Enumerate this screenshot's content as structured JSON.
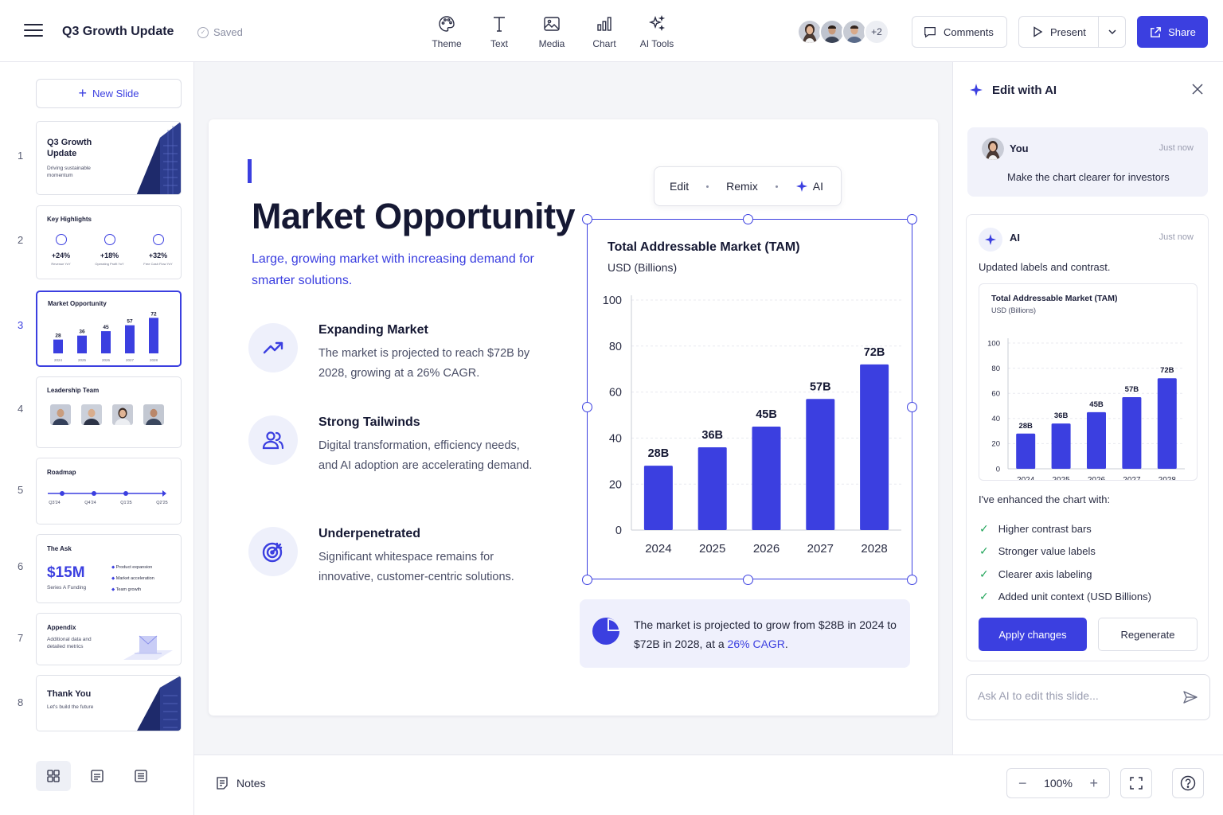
{
  "app": {
    "doc_title": "Q3 Growth Update",
    "saved_label": "Saved"
  },
  "toolbar": {
    "tools": [
      {
        "label": "Theme",
        "icon": "palette-icon"
      },
      {
        "label": "Text",
        "icon": "text-icon"
      },
      {
        "label": "Media",
        "icon": "image-icon"
      },
      {
        "label": "Chart",
        "icon": "chart-icon"
      },
      {
        "label": "AI Tools",
        "icon": "sparkles-icon"
      }
    ],
    "collaborators_more": "+2",
    "comments_label": "Comments",
    "present_label": "Present",
    "share_label": "Share"
  },
  "sidebar": {
    "new_slide_label": "New Slide",
    "thumbs": [
      {
        "num": "1",
        "title": "Q3 Growth Update",
        "subtitle": "Driving sustainable momentum"
      },
      {
        "num": "2",
        "title": "Key Highlights",
        "stats": [
          "+24%",
          "+18%",
          "+32%"
        ],
        "stat_labels": [
          "Revenue YoY",
          "Operating Profit YoY",
          "Free Cash Flow YoY"
        ]
      },
      {
        "num": "3",
        "title": "Market Opportunity",
        "values": [
          "28",
          "36",
          "45",
          "57",
          "72"
        ],
        "years": [
          "2024",
          "2025",
          "2026",
          "2027",
          "2028"
        ]
      },
      {
        "num": "4",
        "title": "Leadership Team"
      },
      {
        "num": "5",
        "title": "Roadmap",
        "quarters": [
          "Q3'24",
          "Q4'24",
          "Q1'25",
          "Q2'25"
        ]
      },
      {
        "num": "6",
        "title": "The Ask",
        "amount": "$15M",
        "amount_sub": "Series A Funding",
        "bullets": [
          "Product expansion",
          "Market acceleration",
          "Team growth"
        ]
      },
      {
        "num": "7",
        "title": "Appendix",
        "subtitle": "Additional data and detailed metrics"
      },
      {
        "num": "8",
        "title": "Thank You",
        "subtitle": "Let's build the future"
      }
    ]
  },
  "slide": {
    "title": "Market Opportunity",
    "subtitle": "Large, growing market with increasing demand for smarter solutions.",
    "features": [
      {
        "title": "Expanding Market",
        "desc": "The market is projected to reach $72B by 2028, growing at a 26% CAGR.",
        "icon": "trend-up-icon"
      },
      {
        "title": "Strong Tailwinds",
        "desc": "Digital transformation, efficiency needs, and AI adoption are accelerating demand.",
        "icon": "users-icon"
      },
      {
        "title": "Underpenetrated",
        "desc": "Significant whitespace remains for innovative, customer-centric solutions.",
        "icon": "target-icon"
      }
    ],
    "float_toolbar": {
      "edit": "Edit",
      "remix": "Remix",
      "ai": "AI"
    },
    "insight_text": "The market is projected to grow from $28B in 2024 to $72B in 2028, at a ",
    "insight_highlight": "26% CAGR",
    "insight_end": "."
  },
  "chart_data": {
    "type": "bar",
    "title": "Total Addressable Market (TAM)",
    "ylabel": "USD (Billions)",
    "categories": [
      "2024",
      "2025",
      "2026",
      "2027",
      "2028"
    ],
    "values": [
      28,
      36,
      45,
      57,
      72
    ],
    "data_labels": [
      "28B",
      "36B",
      "45B",
      "57B",
      "72B"
    ],
    "ylim": [
      0,
      100
    ],
    "yticks": [
      0,
      20,
      40,
      60,
      80,
      100
    ],
    "grid": true,
    "bar_color": "#3b3fe0"
  },
  "bottom": {
    "notes_label": "Notes",
    "zoom": "100%"
  },
  "ai_panel": {
    "title": "Edit with AI",
    "user_name": "You",
    "user_time": "Just now",
    "user_message": "Make the chart clearer for investors",
    "ai_name": "AI",
    "ai_time": "Just now",
    "ai_message": "Updated labels and contrast.",
    "enhanced_intro": "I've enhanced the chart with:",
    "enhancements": [
      "Higher contrast bars",
      "Stronger value labels",
      "Clearer axis labeling",
      "Added unit context (USD Billions)"
    ],
    "apply_label": "Apply changes",
    "regenerate_label": "Regenerate",
    "ask_placeholder": "Ask AI to edit this slide..."
  },
  "colors": {
    "accent": "#3b3fe0",
    "accent_soft": "#eef0fb",
    "check": "#22a55b"
  }
}
